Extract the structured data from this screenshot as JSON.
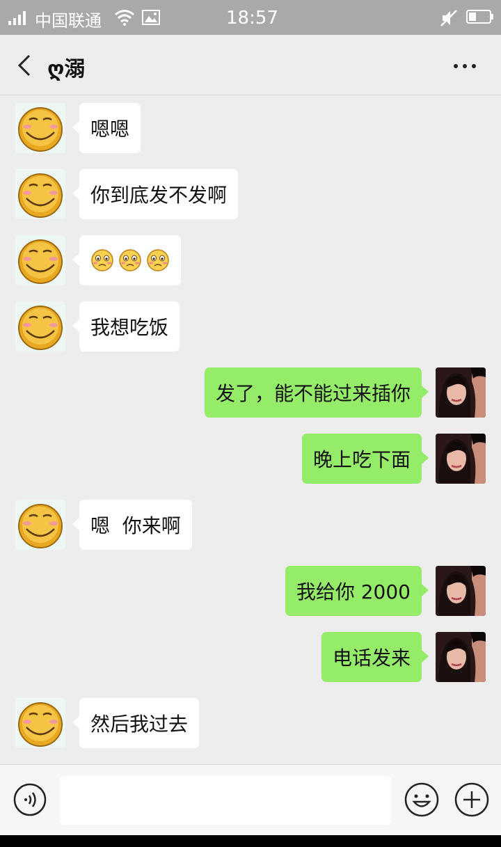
{
  "status_bar": {
    "carrier": "中国联通",
    "time": "18:57",
    "icons": [
      "signal-icon",
      "wifi-icon",
      "image-notification-icon",
      "mute-icon",
      "battery-icon"
    ]
  },
  "header": {
    "back_icon": "chevron-left-icon",
    "title": "ღ溺",
    "more_icon": "more-dots-icon"
  },
  "messages": [
    {
      "side": "in",
      "text": "嗯嗯"
    },
    {
      "side": "in",
      "text": "你到底发不发啊"
    },
    {
      "side": "in",
      "emoji": [
        "blush-emoji",
        "blush-emoji",
        "blush-emoji"
      ]
    },
    {
      "side": "in",
      "text": "我想吃饭"
    },
    {
      "side": "out",
      "text": "发了，能不能过来插你"
    },
    {
      "side": "out",
      "text": "晚上吃下面"
    },
    {
      "side": "in",
      "text": "嗯  你来啊"
    },
    {
      "side": "out",
      "text": "我给你 2000"
    },
    {
      "side": "out",
      "text": "电话发来"
    },
    {
      "side": "in",
      "text": "然后我过去"
    }
  ],
  "input_bar": {
    "voice_icon": "voice-icon",
    "input_value": "",
    "emoji_icon": "emoji-icon",
    "plus_icon": "plus-icon"
  },
  "colors": {
    "outgoing_bubble": "#95ec69",
    "incoming_bubble": "#ffffff",
    "background": "#ededed",
    "status_bar": "#a9a9a9"
  }
}
